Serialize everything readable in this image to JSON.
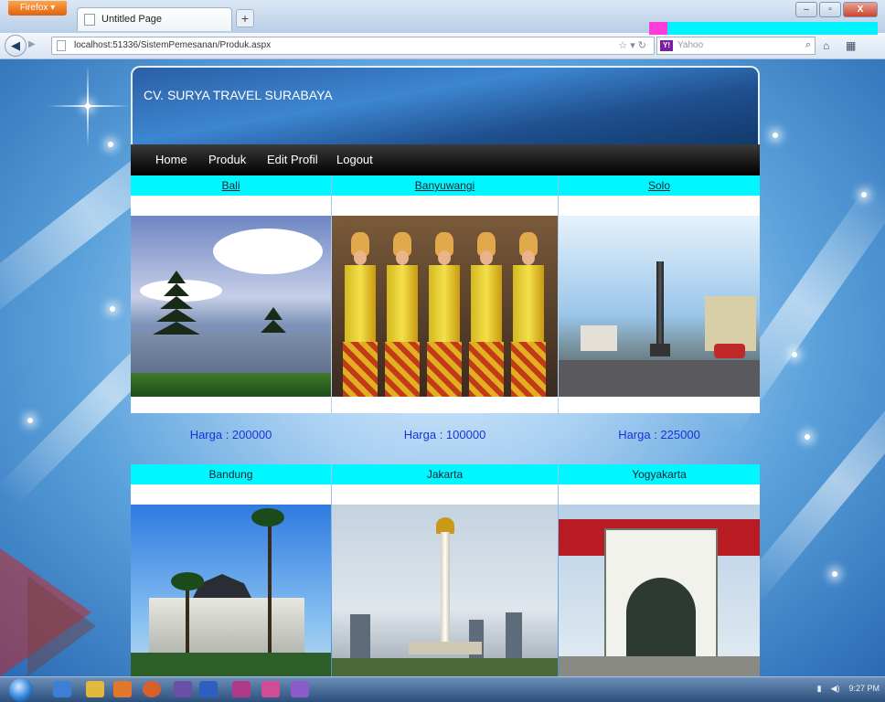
{
  "browser": {
    "firefox_label": "Firefox ▾",
    "tab_title": "Untitled Page",
    "new_tab": "+",
    "url": "localhost:51336/SistemPemesanan/Produk.aspx",
    "search_placeholder": "Yahoo",
    "search_engine_badge": "Y!",
    "win_minimize": "–",
    "win_maximize": "▫",
    "win_close": "X"
  },
  "site": {
    "title": "CV. SURYA TRAVEL SURABAYA",
    "menu": [
      "Home",
      "Produk",
      "Edit Profil",
      "Logout"
    ]
  },
  "products": [
    {
      "name": "Bali",
      "price_label": "Harga : 200000"
    },
    {
      "name": "Banyuwangi",
      "price_label": "Harga : 100000"
    },
    {
      "name": "Solo",
      "price_label": "Harga : 225000"
    },
    {
      "name": "Bandung",
      "price_label": ""
    },
    {
      "name": "Jakarta",
      "price_label": ""
    },
    {
      "name": "Yogyakarta",
      "price_label": ""
    }
  ],
  "taskbar": {
    "clock": "9:27 PM"
  },
  "colors": {
    "cell_header": "#00f7ff",
    "price_text": "#1a33d6",
    "menu_bar": "#000000"
  }
}
